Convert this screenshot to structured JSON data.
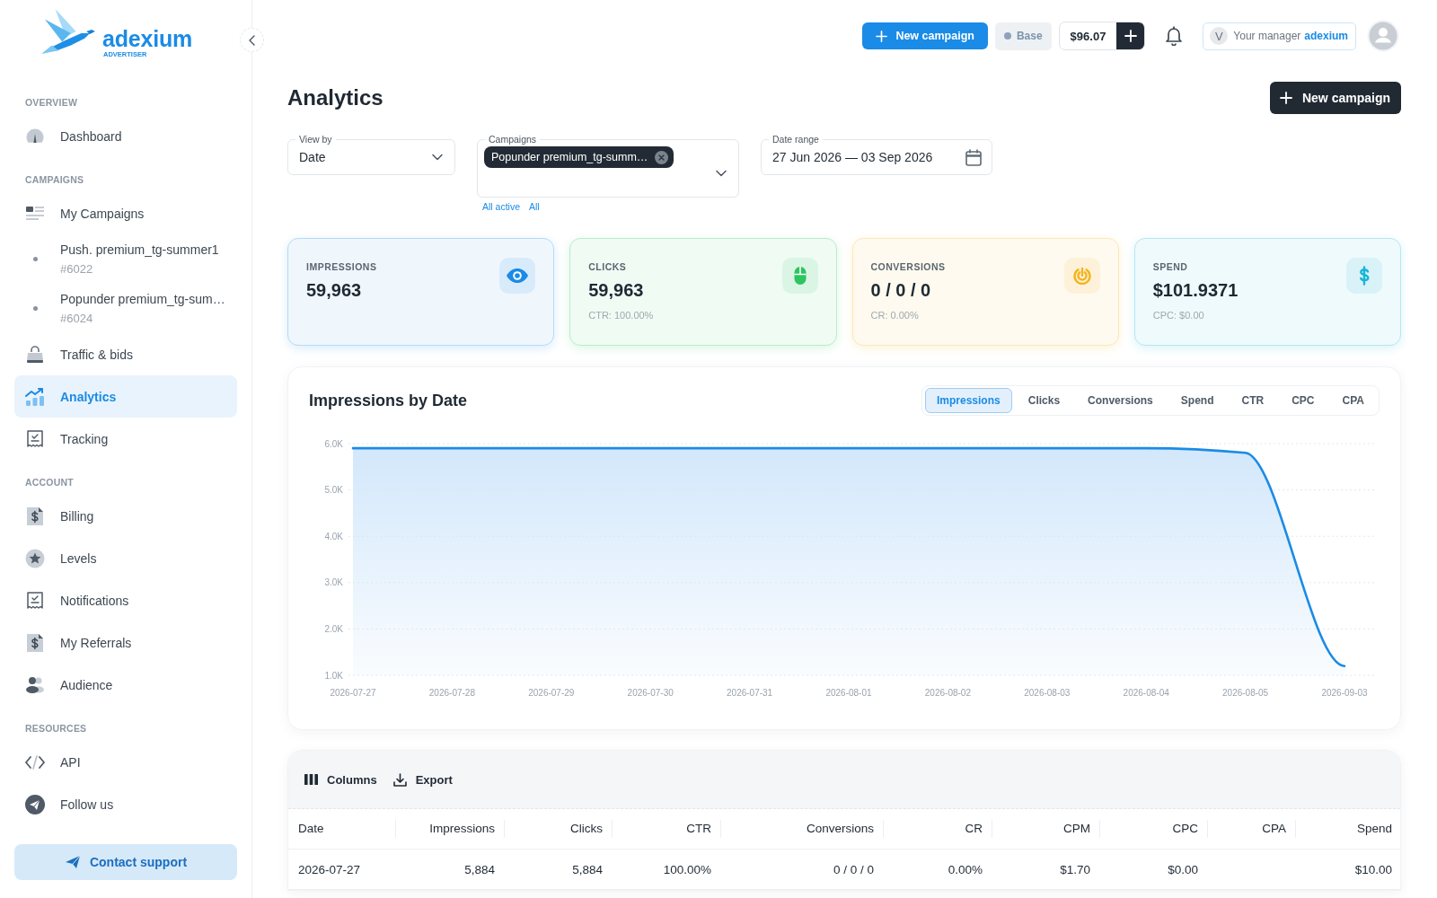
{
  "sidebar": {
    "logo": {
      "wordmark": "adexium",
      "tagline": "ADVERTISER"
    },
    "sections": [
      {
        "title": "OVERVIEW",
        "items": [
          {
            "kind": "link",
            "label": "Dashboard",
            "selected": false
          }
        ]
      },
      {
        "title": "CAMPAIGNS",
        "items": [
          {
            "kind": "link",
            "label": "My Campaigns",
            "selected": false
          },
          {
            "kind": "campaign",
            "label": "Push. premium_tg-summer1",
            "number": "#6022",
            "selected": false
          },
          {
            "kind": "campaign",
            "label": "Popunder premium_tg-sum…",
            "number": "#6024",
            "selected": false
          },
          {
            "kind": "link",
            "label": "Traffic & bids",
            "selected": false
          },
          {
            "kind": "link",
            "label": "Analytics",
            "selected": true
          },
          {
            "kind": "link",
            "label": "Tracking",
            "selected": false
          }
        ]
      },
      {
        "title": "ACCOUNT",
        "items": [
          {
            "kind": "link",
            "label": "Billing",
            "selected": false
          },
          {
            "kind": "link",
            "label": "Levels",
            "selected": false
          },
          {
            "kind": "link",
            "label": "Notifications",
            "selected": false
          },
          {
            "kind": "link",
            "label": "My Referrals",
            "selected": false
          },
          {
            "kind": "link",
            "label": "Audience",
            "selected": false
          }
        ]
      },
      {
        "title": "RESOURCES",
        "items": [
          {
            "kind": "link",
            "label": "API",
            "selected": false
          },
          {
            "kind": "link",
            "label": "Follow us",
            "selected": false
          }
        ]
      }
    ],
    "support_button": "Contact support"
  },
  "topbar": {
    "new_campaign_button": "New campaign",
    "plan": "Base",
    "balance": "$96.07",
    "manager": {
      "initial": "V",
      "label": "Your manager",
      "name": "adexium"
    }
  },
  "header": {
    "title": "Analytics",
    "new_campaign_button": "New campaign"
  },
  "filters": {
    "view_by": {
      "label": "View by",
      "value": "Date"
    },
    "campaigns": {
      "label": "Campaigns",
      "chips": [
        "Popunder premium_tg-summ…"
      ],
      "links": [
        "All active",
        "All"
      ]
    },
    "date_range": {
      "label": "Date range",
      "value": "27 Jun 2026 — 03 Sep 2026"
    }
  },
  "stats": [
    {
      "label": "IMPRESSIONS",
      "value": "59,963",
      "color": "#1a8be6"
    },
    {
      "label": "CLICKS",
      "value": "59,963",
      "note": "CTR: 100.00%",
      "color": "#2cc55f"
    },
    {
      "label": "CONVERSIONS",
      "value": "0 / 0 / 0",
      "note": "CR: 0.00%",
      "color": "#f5b41e"
    },
    {
      "label": "SPEND",
      "value": "$101.9371",
      "note": "CPC: $0.00",
      "color": "#18b4d8"
    }
  ],
  "chart": {
    "tabs": [
      {
        "label": "Impressions",
        "selected": true
      },
      {
        "label": "Clicks",
        "selected": false
      },
      {
        "label": "Conversions",
        "selected": false
      },
      {
        "label": "Spend",
        "selected": false
      },
      {
        "label": "CTR",
        "selected": false
      },
      {
        "label": "CPC",
        "selected": false
      },
      {
        "label": "CPA",
        "selected": false
      }
    ],
    "chart_data": {
      "type": "area",
      "title": "Impressions by Date",
      "categories": [
        "2026-07-27",
        "2026-07-28",
        "2026-07-29",
        "2026-07-30",
        "2026-07-31",
        "2026-08-01",
        "2026-08-02",
        "2026-08-03",
        "2026-08-04",
        "2026-08-05",
        "2026-09-03"
      ],
      "values": [
        5900,
        5900,
        5900,
        5900,
        5900,
        5900,
        5900,
        5900,
        5900,
        5800,
        1200
      ],
      "ylim": [
        1000,
        6000
      ],
      "yticks": [
        {
          "value": 1000,
          "label": "1.0K"
        },
        {
          "value": 2000,
          "label": "2.0K"
        },
        {
          "value": 3000,
          "label": "3.0K"
        },
        {
          "value": 4000,
          "label": "4.0K"
        },
        {
          "value": 5000,
          "label": "5.0K"
        },
        {
          "value": 6000,
          "label": "6.0K"
        }
      ],
      "grid": true
    }
  },
  "table": {
    "toolbar": [
      "Columns",
      "Export"
    ],
    "columns": [
      "Date",
      "Impressions",
      "Clicks",
      "CTR",
      "Conversions",
      "CR",
      "CPM",
      "CPC",
      "CPA",
      "Spend"
    ],
    "rows": [
      {
        "cells": [
          "2026-07-27",
          "5,884",
          "5,884",
          "100.00%",
          "0 / 0 / 0",
          "0.00%",
          "$1.70",
          "$0.00",
          null,
          "$10.00"
        ]
      }
    ]
  }
}
